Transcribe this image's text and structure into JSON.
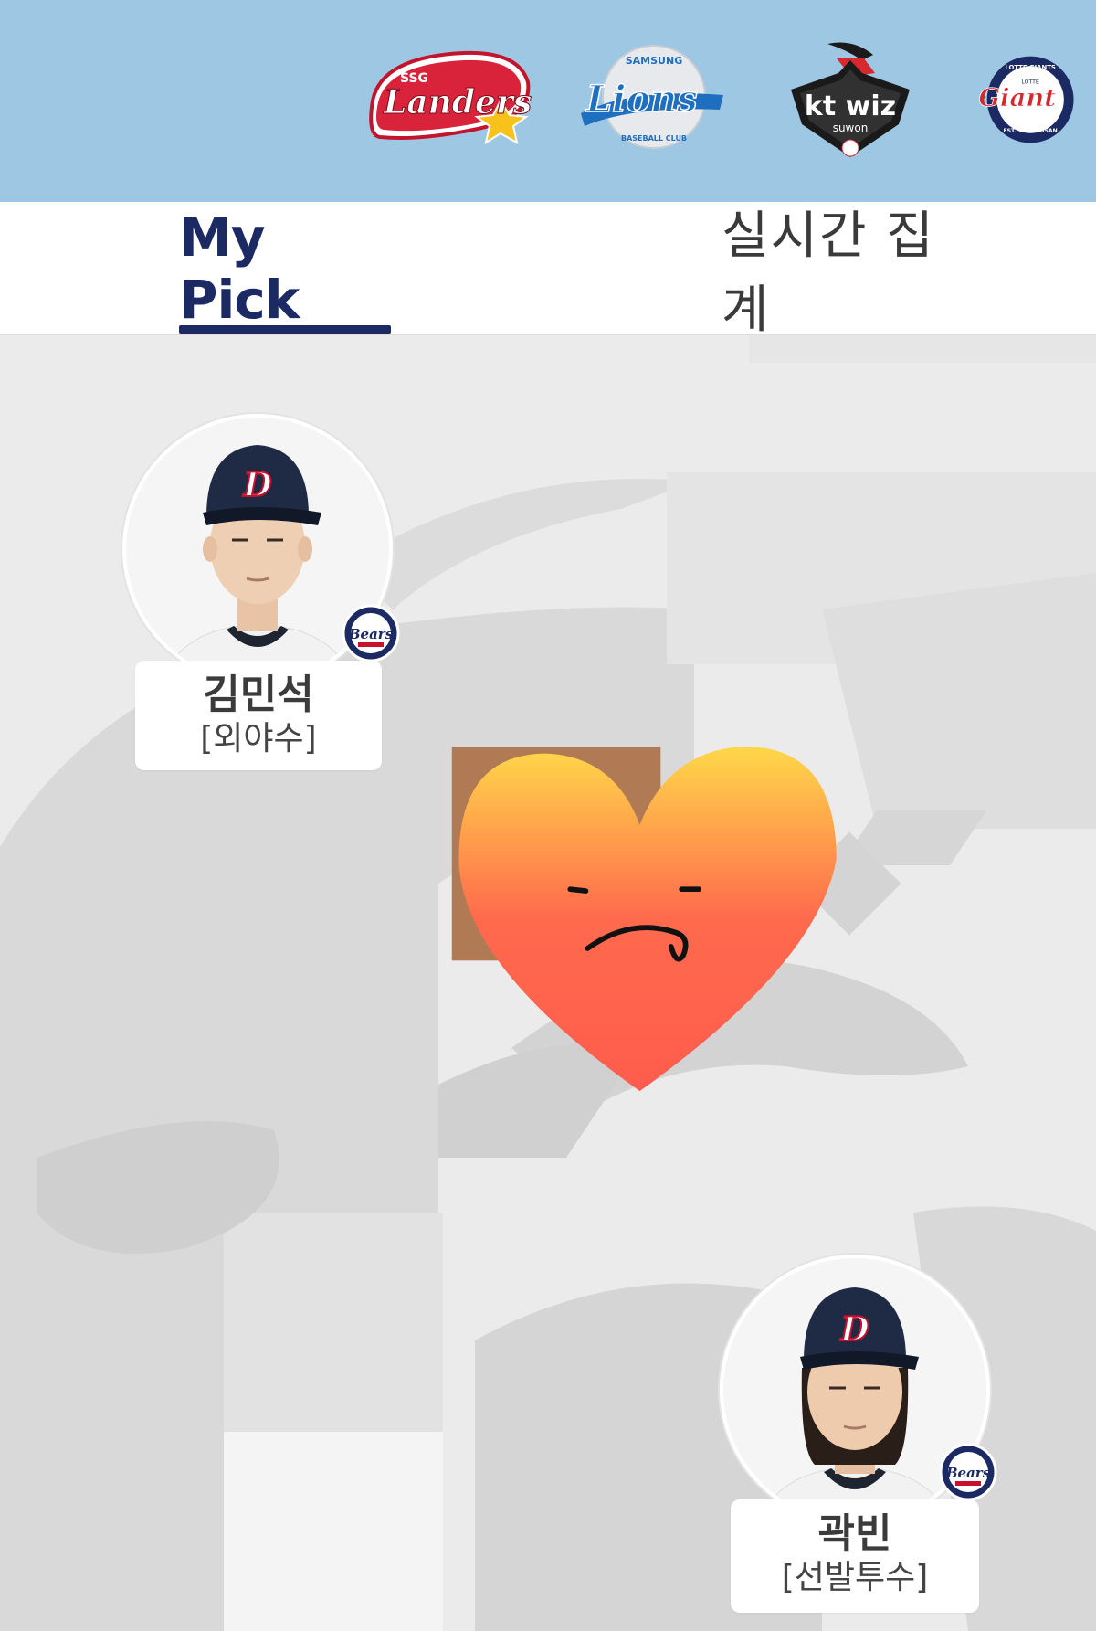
{
  "teams": [
    {
      "name": "SSG Landers",
      "top_text": "SSG",
      "main_text": "Landers",
      "color": "#d9233a"
    },
    {
      "name": "Samsung Lions",
      "top_text": "SAMSUNG",
      "main_text": "Lions",
      "bottom_text": "BASEBALL CLUB",
      "color": "#1f6fc0"
    },
    {
      "name": "kt wiz",
      "main_text": "kt wiz",
      "bottom_text": "suwon",
      "color": "#1a1a1a"
    },
    {
      "name": "Lotte Giants",
      "top_text": "LOTTE GIANTS",
      "inner_top": "LOTTE",
      "main_text": "Giant",
      "bottom_text": "EST. 1982 BUSAN",
      "color": "#d7282f"
    }
  ],
  "tabs": {
    "my_pick": "My Pick",
    "live": "실시간 집계"
  },
  "players": [
    {
      "name": "김민석",
      "position": "[외야수]",
      "team_badge": "Bears",
      "cap_letter": "D"
    },
    {
      "name": "곽빈",
      "position": "[선발투수]",
      "team_badge": "Bears",
      "cap_letter": "D"
    }
  ],
  "colors": {
    "banner": "#9ec7e3",
    "tab_active": "#1b2a63",
    "field": "#ebebeb"
  },
  "sticker": {
    "icon": "pouting-heart-icon"
  }
}
